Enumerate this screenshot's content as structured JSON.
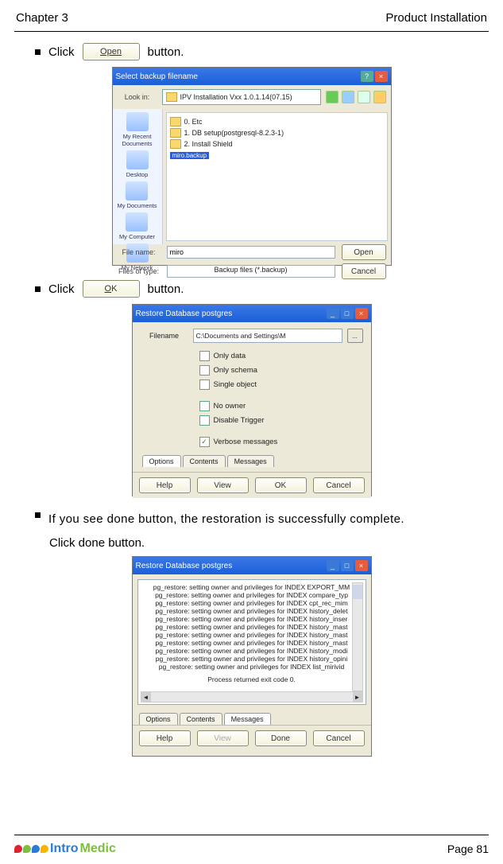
{
  "header": {
    "chapter": "Chapter 3",
    "section": "Product Installation"
  },
  "bullets": {
    "click_prefix": "Click ",
    "button_suffix": "button.",
    "open_label": "Open",
    "ok_label": "OK",
    "done_text_line": "If  you  see  done  button,  the  restoration  is  successfully  complete.",
    "done_text_line2": "Click done button."
  },
  "file_dialog": {
    "title": "Select backup filename",
    "lookin_label": "Look in:",
    "lookin_value": "IPV Installation Vxx 1.0.1.14(07.15)",
    "items": [
      "0. Etc",
      "1. DB setup(postgresql-8.2.3-1)",
      "2. Install Shield"
    ],
    "selected_item": "miro.backup",
    "places": [
      "My Recent Documents",
      "Desktop",
      "My Documents",
      "My Computer",
      "My Network"
    ],
    "filename_label": "File name:",
    "filename_value": "miro",
    "filetype_label": "Files of type:",
    "filetype_value": "Backup files (*.backup)",
    "open_btn": "Open",
    "cancel_btn": "Cancel"
  },
  "restore_options": {
    "title": "Restore Database postgres",
    "filename_label": "Filename",
    "filename_value": "C:\\Documents and Settings\\M",
    "browse": "...",
    "opts": {
      "only_data": "Only data",
      "only_schema": "Only schema",
      "single_object": "Single object",
      "no_owner": "No owner",
      "disable_trigger": "Disable Trigger",
      "verbose": "Verbose messages"
    },
    "tabs": {
      "options": "Options",
      "contents": "Contents",
      "messages": "Messages"
    },
    "buttons": {
      "help": "Help",
      "view": "View",
      "ok": "OK",
      "cancel": "Cancel"
    }
  },
  "restore_messages": {
    "title": "Restore Database postgres",
    "lines": [
      "pg_restore: setting owner and privileges for INDEX EXPORT_MM",
      "pg_restore: setting owner and privileges for INDEX compare_typ",
      "pg_restore: setting owner and privileges for INDEX cpt_rec_mim",
      "pg_restore: setting owner and privileges for INDEX history_delet",
      "pg_restore: setting owner and privileges for INDEX history_inser",
      "pg_restore: setting owner and privileges for INDEX history_mast",
      "pg_restore: setting owner and privileges for INDEX history_mast",
      "pg_restore: setting owner and privileges for INDEX history_mast",
      "pg_restore: setting owner and privileges for INDEX history_modi",
      "pg_restore: setting owner and privileges for INDEX history_opini",
      "pg_restore: setting owner and privileges for INDEX list_mirivid"
    ],
    "process_line": "Process returned exit code 0.",
    "tabs": {
      "options": "Options",
      "contents": "Contents",
      "messages": "Messages"
    },
    "buttons": {
      "help": "Help",
      "view": "View",
      "done": "Done",
      "cancel": "Cancel"
    }
  },
  "footer": {
    "page": "Page 81",
    "logo_a": "Intro",
    "logo_b": "Medic"
  }
}
